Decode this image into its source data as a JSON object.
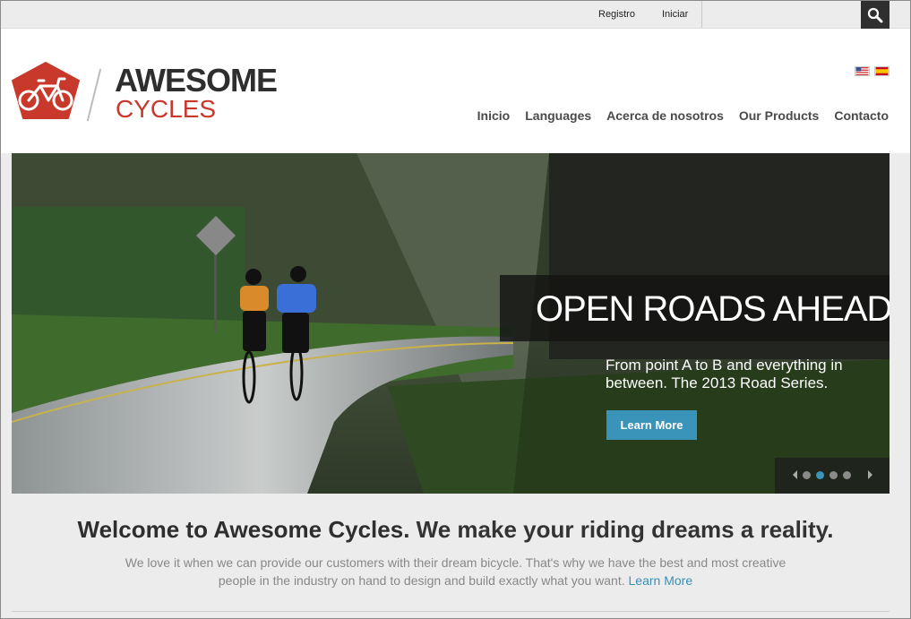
{
  "topbar": {
    "register_label": "Registro",
    "login_label": "Iniciar",
    "search_icon": "search-icon"
  },
  "brand": {
    "name_line1": "AWESOME",
    "name_line2": "CYCLES",
    "accent_color": "#c8392b"
  },
  "languages": [
    "us-flag",
    "es-flag"
  ],
  "nav": {
    "items": [
      {
        "label": "Inicio"
      },
      {
        "label": "Languages"
      },
      {
        "label": "Acerca de nosotros"
      },
      {
        "label": "Our Products"
      },
      {
        "label": "Contacto"
      }
    ]
  },
  "hero": {
    "title": "OPEN ROADS AHEAD",
    "text": "From point A to B and everything in between. The 2013 Road Series.",
    "button_label": "Learn More",
    "button_color": "#3a93b8",
    "slides_total": 4,
    "active_slide": 2
  },
  "welcome": {
    "bold": "Welcome to Awesome Cycles.",
    "rest": " We make your riding dreams a reality.",
    "intro": "We love it when we can provide our customers with their dream bicycle. That's why we have the best and most creative people in the industry on hand to design and build exactly what you want. ",
    "link_label": "Learn More"
  }
}
